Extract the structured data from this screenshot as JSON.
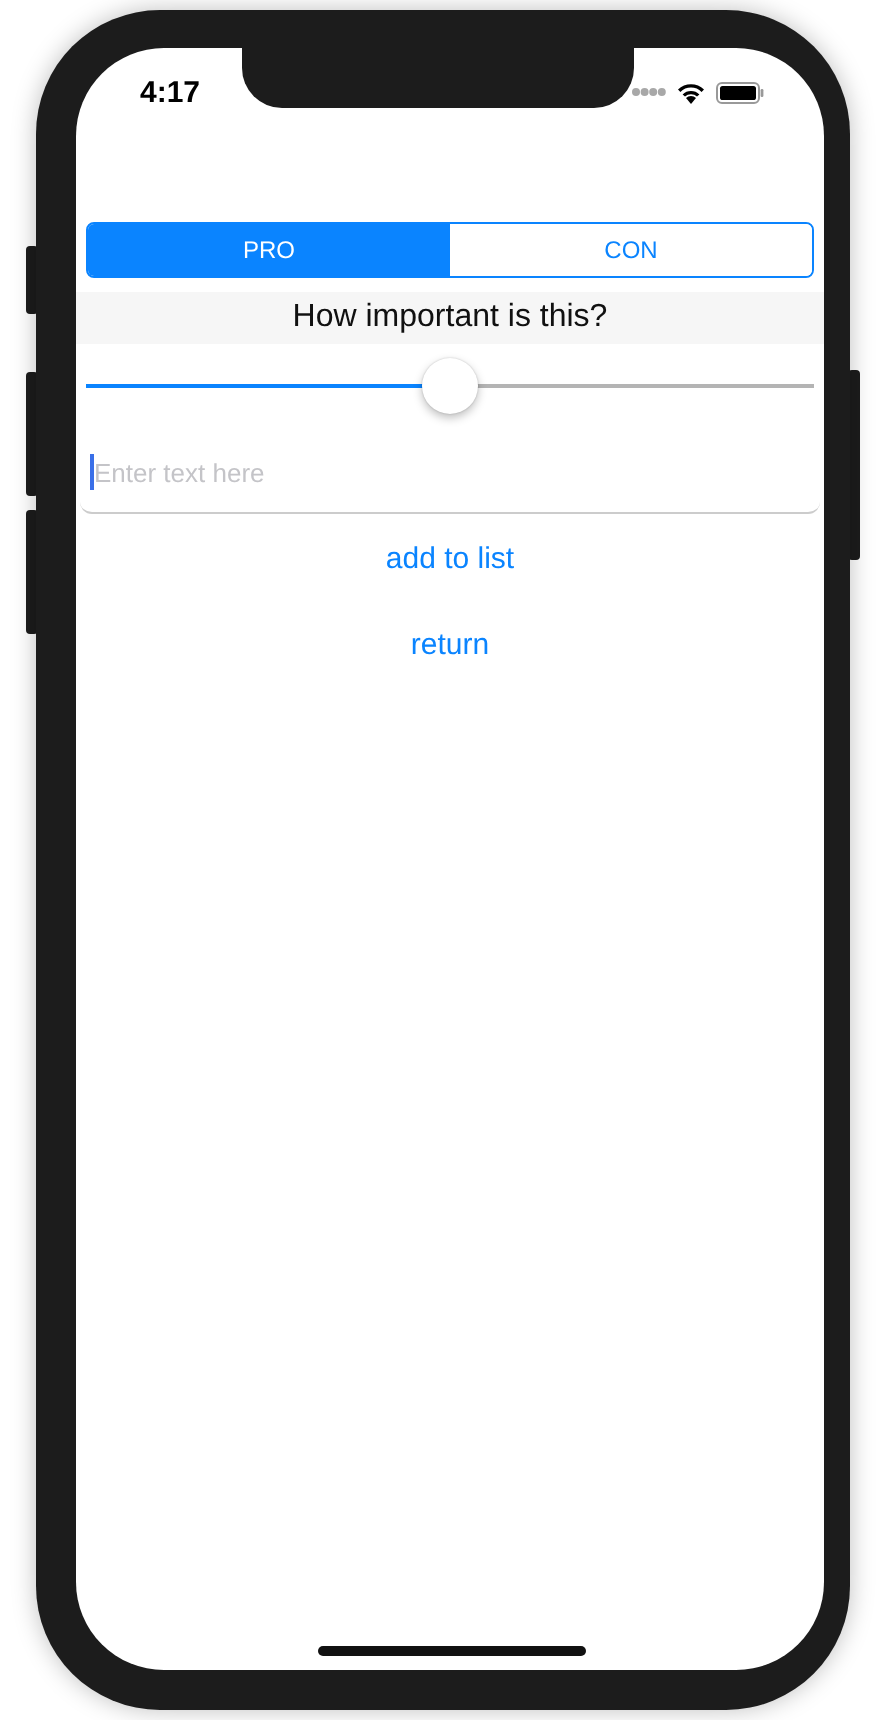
{
  "status_bar": {
    "time": "4:17"
  },
  "segmented_control": [
    {
      "label": "PRO",
      "selected": true
    },
    {
      "label": "CON",
      "selected": false
    }
  ],
  "question": "How important is this?",
  "importance_slider": {
    "level": 0.5
  },
  "text_field": {
    "placeholder": "Enter text here",
    "focused": true
  },
  "buttons": [
    "add to list",
    "return"
  ]
}
